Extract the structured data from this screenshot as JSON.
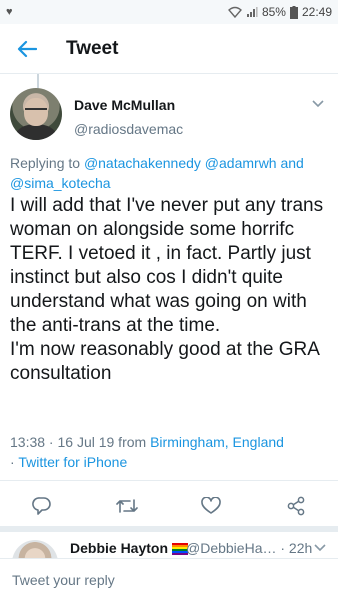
{
  "status_bar": {
    "left_icon": "heart-icon",
    "battery": "85%",
    "time": "22:49"
  },
  "app_bar": {
    "title": "Tweet",
    "back_icon": "back-arrow-icon"
  },
  "tweet": {
    "display_name": "Dave McMullan",
    "handle": "@radiosdavemac",
    "replying_prefix": "Replying to ",
    "mention_1": "@natachakennedy",
    "mention_2": "@adamrwh",
    "and_word": " and",
    "mention_3": "@sima_kotecha",
    "text": "I will add that I've never put any trans woman on alongside some horrifc TERF. I vetoed it , in fact. Partly just instinct but also cos I didn't quite understand what was going on with the anti-trans at the time.\nI'm now reasonably good at the GRA consultation",
    "timestamp": "13:38 · 16 Jul 19 from ",
    "location": "Birmingham, England",
    "source_prefix": "· ",
    "source": "Twitter for iPhone"
  },
  "actions": [
    "reply-icon",
    "retweet-icon",
    "like-icon",
    "share-icon"
  ],
  "reply_preview": {
    "display_name": "Debbie Hayton",
    "handle_time": "@DebbieHa… · 22h"
  },
  "compose": {
    "placeholder": "Tweet your reply"
  },
  "colors": {
    "accent": "#1b95e0",
    "text": "#14171a",
    "secondary": "#657786",
    "divider": "#e6ecf0"
  }
}
